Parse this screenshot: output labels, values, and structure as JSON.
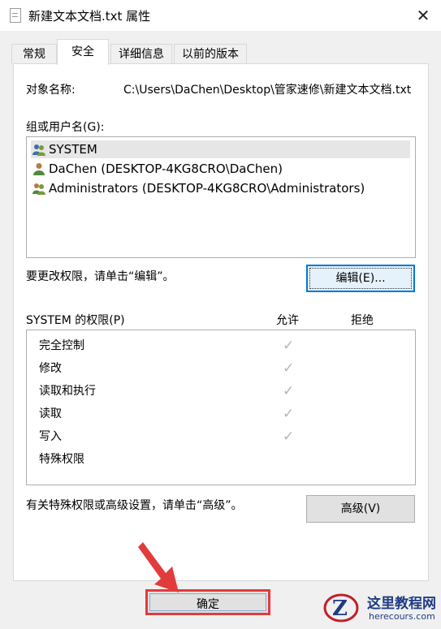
{
  "window": {
    "title": "新建文本文档.txt 属性",
    "close_glyph": "✕"
  },
  "tabs": [
    {
      "label": "常规"
    },
    {
      "label": "安全"
    },
    {
      "label": "详细信息"
    },
    {
      "label": "以前的版本"
    }
  ],
  "security": {
    "object_name_label": "对象名称:",
    "object_name_value": "C:\\Users\\DaChen\\Desktop\\管家速修\\新建文本文档.txt",
    "groups_label": "组或用户名(G):",
    "users": [
      {
        "name": "SYSTEM",
        "icon": "group-users-icon",
        "selected": true
      },
      {
        "name": "DaChen (DESKTOP-4KG8CRO\\DaChen)",
        "icon": "user-icon",
        "selected": false
      },
      {
        "name": "Administrators (DESKTOP-4KG8CRO\\Administrators)",
        "icon": "group-users-icon",
        "selected": false
      }
    ],
    "edit_hint": "要更改权限，请单击“编辑”。",
    "edit_button": "编辑(E)...",
    "permissions_label": "SYSTEM 的权限(P)",
    "allow_header": "允许",
    "deny_header": "拒绝",
    "permissions": [
      {
        "name": "完全控制",
        "allow": true,
        "deny": false
      },
      {
        "name": "修改",
        "allow": true,
        "deny": false
      },
      {
        "name": "读取和执行",
        "allow": true,
        "deny": false
      },
      {
        "name": "读取",
        "allow": true,
        "deny": false
      },
      {
        "name": "写入",
        "allow": true,
        "deny": false
      },
      {
        "name": "特殊权限",
        "allow": false,
        "deny": false
      }
    ],
    "advanced_hint": "有关特殊权限或高级设置，请单击“高级”。",
    "advanced_button": "高级(V)"
  },
  "footer": {
    "ok_button": "确定"
  },
  "watermark": {
    "text": "这里教程网",
    "url": "herecours.com"
  },
  "colors": {
    "accent": "#0078d7",
    "highlight_box": "#e23b3b",
    "check": "#b4b4b4"
  }
}
